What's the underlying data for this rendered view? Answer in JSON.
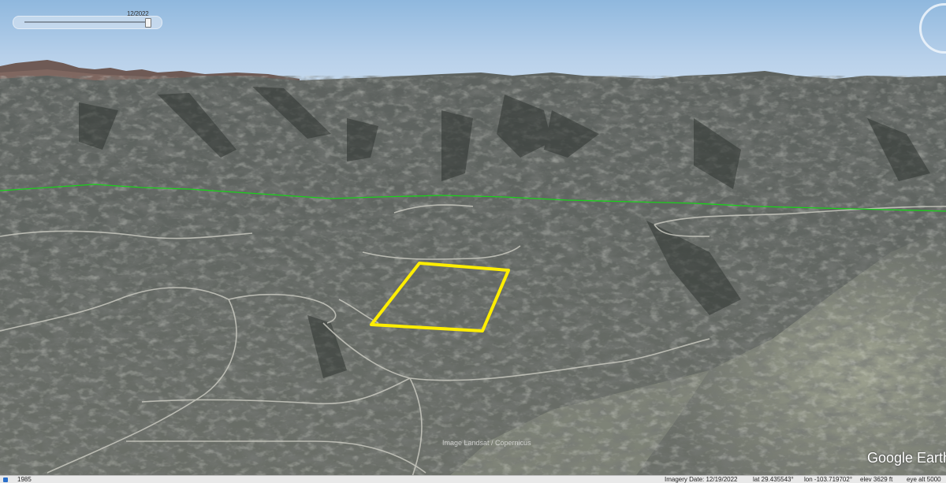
{
  "time_slider": {
    "date_label": "12/2022"
  },
  "copyright": "Image Landsat / Copernicus",
  "brand": "Google Earth",
  "status_bar": {
    "year": "1985",
    "imagery_date": "Imagery Date: 12/19/2022",
    "lat": "lat  29.435543°",
    "lon": "lon -103.719702°",
    "elev": "elev  3629 ft",
    "eye_alt": "eye alt  5000"
  },
  "overlays": {
    "boundary_color": "#ffee00",
    "line_color": "#1ad11a"
  },
  "icons": {
    "compass": "compass-icon",
    "slider_thumb": "slider-thumb-icon"
  }
}
